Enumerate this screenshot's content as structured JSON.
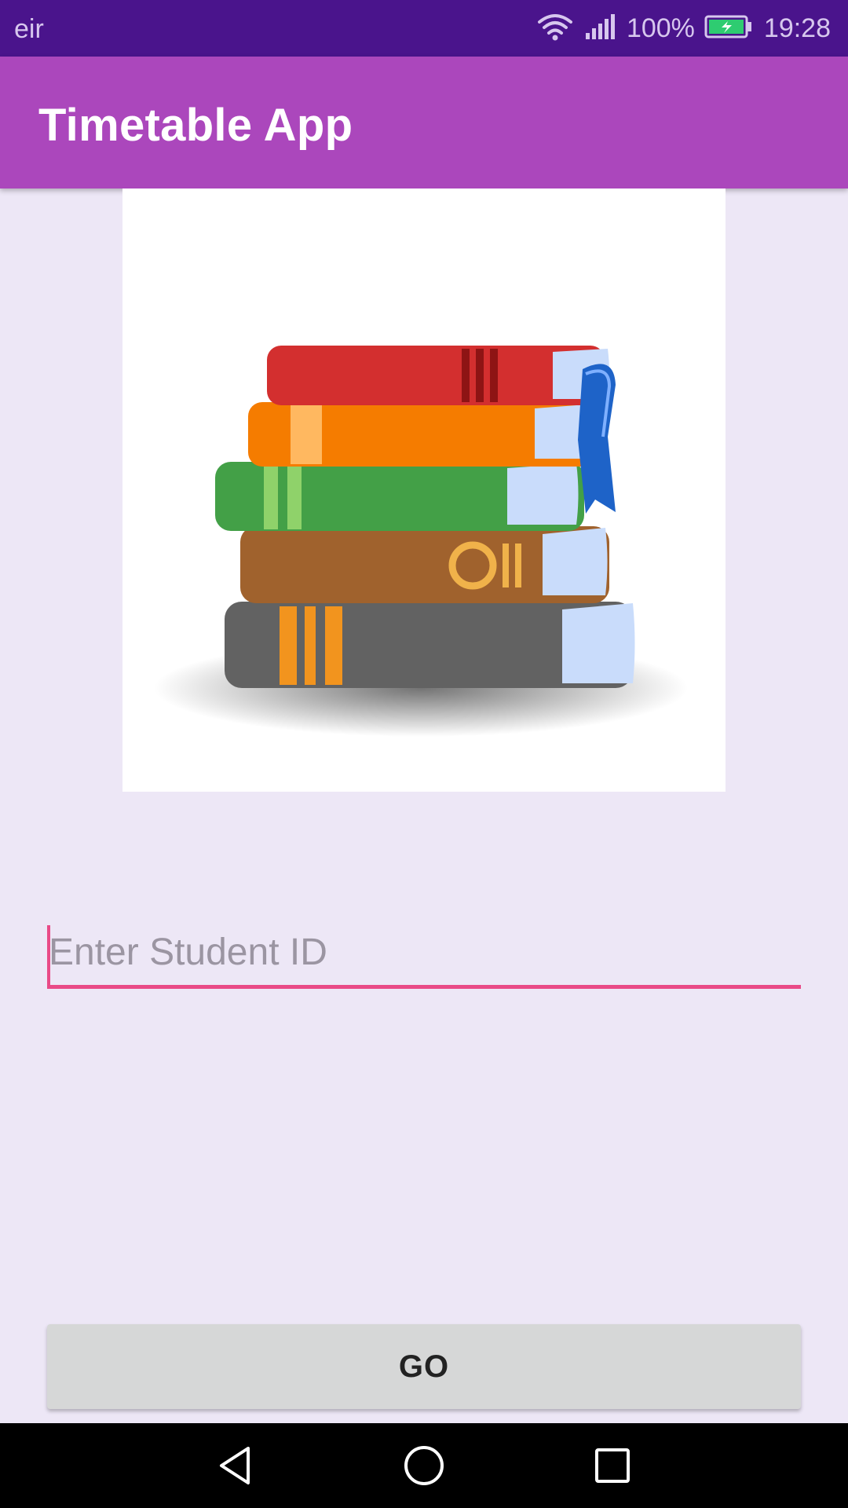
{
  "status_bar": {
    "carrier": "eir",
    "battery_percent": "100%",
    "time": "19:28",
    "icons": [
      "wifi-icon",
      "signal-icon",
      "battery-charging-icon"
    ]
  },
  "app_bar": {
    "title": "Timetable App"
  },
  "hero": {
    "icon": "books-stack-icon",
    "colors": [
      "#d32f2f",
      "#f57c00",
      "#43a047",
      "#a0622d",
      "#616161",
      "#1e63c8"
    ]
  },
  "form": {
    "student_id_placeholder": "Enter Student ID",
    "student_id_value": "",
    "go_label": "GO"
  },
  "nav_bar": {
    "icons": [
      "back-icon",
      "home-icon",
      "recents-icon"
    ]
  },
  "colors": {
    "status_bar": "#4a148c",
    "app_bar": "#ab47bc",
    "background": "#ede7f6",
    "accent": "#e94a87",
    "button": "#d6d7d7"
  }
}
